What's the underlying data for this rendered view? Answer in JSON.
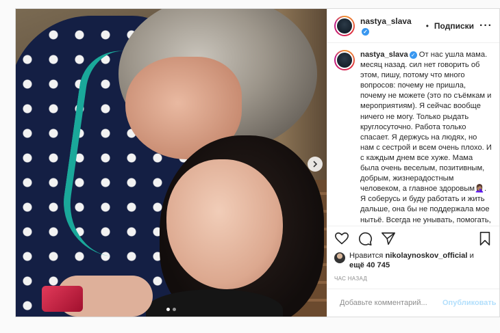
{
  "post": {
    "username": "nastya_slava",
    "verified": true,
    "separator": "•",
    "follow_label": "Подписки",
    "more_label": "···",
    "caption_text": "От нас ушла мама. месяц назад. сил нет говорить об этом, пишу, потому что много вопросов: почему не пришла, почему не можете (это по съёмкам и мероприятиям). Я сейчас вообще ничего не могу. Только рыдать круглосуточно. Работа только спасает. Я держусь на людях, но нам с сестрой и всем очень плохо. И с каждым днем все хуже. Мама была очень веселым, позитивным, добрым, жизнерадостным человеком, а главное здоровым🤦🏽‍♀️. Я соберусь и буду работать и жить дальше, она бы не поддержала мое нытьё. Всегда не унывать, помогать, радовать себя и окружающих. Примите все-все-все мои самые",
    "likes_prefix": "Нравится",
    "likes_user": "nikolaynoskov_official",
    "likes_mid": "и",
    "likes_more": "ещё 40 745",
    "time_label": "ЧАС НАЗАД",
    "comment_placeholder": "Добавьте комментарий...",
    "publish_label": "Опубликовать",
    "photo_count": 2,
    "active_photo": 1
  },
  "icons": {
    "next": "chevron-right-icon",
    "like": "heart-icon",
    "comment": "comment-icon",
    "share": "paper-plane-icon",
    "save": "bookmark-icon",
    "emoji": "smiley-icon"
  },
  "colors": {
    "verified": "#3897f0",
    "publish_disabled": "#b2dffc",
    "border": "#dbdbdb"
  }
}
